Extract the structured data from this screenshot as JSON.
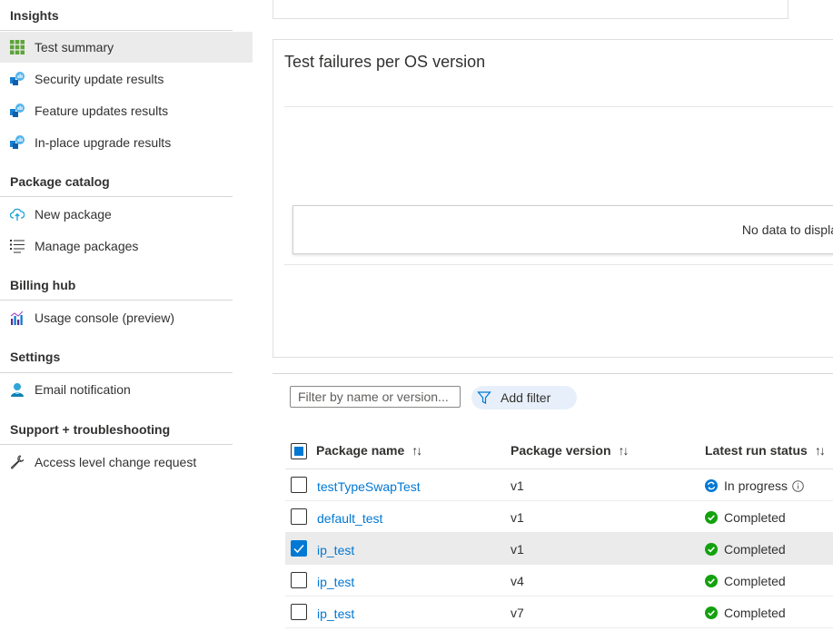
{
  "sidebar": {
    "insights_title": "Insights",
    "insights_items": [
      {
        "label": "Test summary",
        "icon": "grid-icon"
      },
      {
        "label": "Security update results",
        "icon": "results-chart-icon"
      },
      {
        "label": "Feature updates results",
        "icon": "results-chart-icon"
      },
      {
        "label": "In-place upgrade results",
        "icon": "results-chart-icon"
      }
    ],
    "catalog_title": "Package catalog",
    "catalog_items": [
      {
        "label": "New package",
        "icon": "cloud-upload-icon"
      },
      {
        "label": "Manage packages",
        "icon": "list-icon"
      }
    ],
    "billing_title": "Billing hub",
    "billing_items": [
      {
        "label": "Usage console (preview)",
        "icon": "usage-chart-icon"
      }
    ],
    "settings_title": "Settings",
    "settings_items": [
      {
        "label": "Email notification",
        "icon": "person-icon"
      }
    ],
    "support_title": "Support + troubleshooting",
    "support_items": [
      {
        "label": "Access level change request",
        "icon": "wrench-icon"
      }
    ]
  },
  "chart": {
    "title": "Test failures per OS version",
    "no_data": "No data to display"
  },
  "filter": {
    "placeholder": "Filter by name or version...",
    "add_filter": "Add filter"
  },
  "table": {
    "headers": [
      "Package name",
      "Package version",
      "Latest run status"
    ],
    "rows": [
      {
        "name": "testTypeSwapTest",
        "version": "v1",
        "status": "In progress",
        "checked": false
      },
      {
        "name": "default_test",
        "version": "v1",
        "status": "Completed",
        "checked": false
      },
      {
        "name": "ip_test",
        "version": "v1",
        "status": "Completed",
        "checked": true
      },
      {
        "name": "ip_test",
        "version": "v4",
        "status": "Completed",
        "checked": false
      },
      {
        "name": "ip_test",
        "version": "v7",
        "status": "Completed",
        "checked": false
      }
    ]
  },
  "colors": {
    "accent": "#0078d4",
    "success": "#13a10e",
    "selected_bg": "#ebebeb"
  }
}
